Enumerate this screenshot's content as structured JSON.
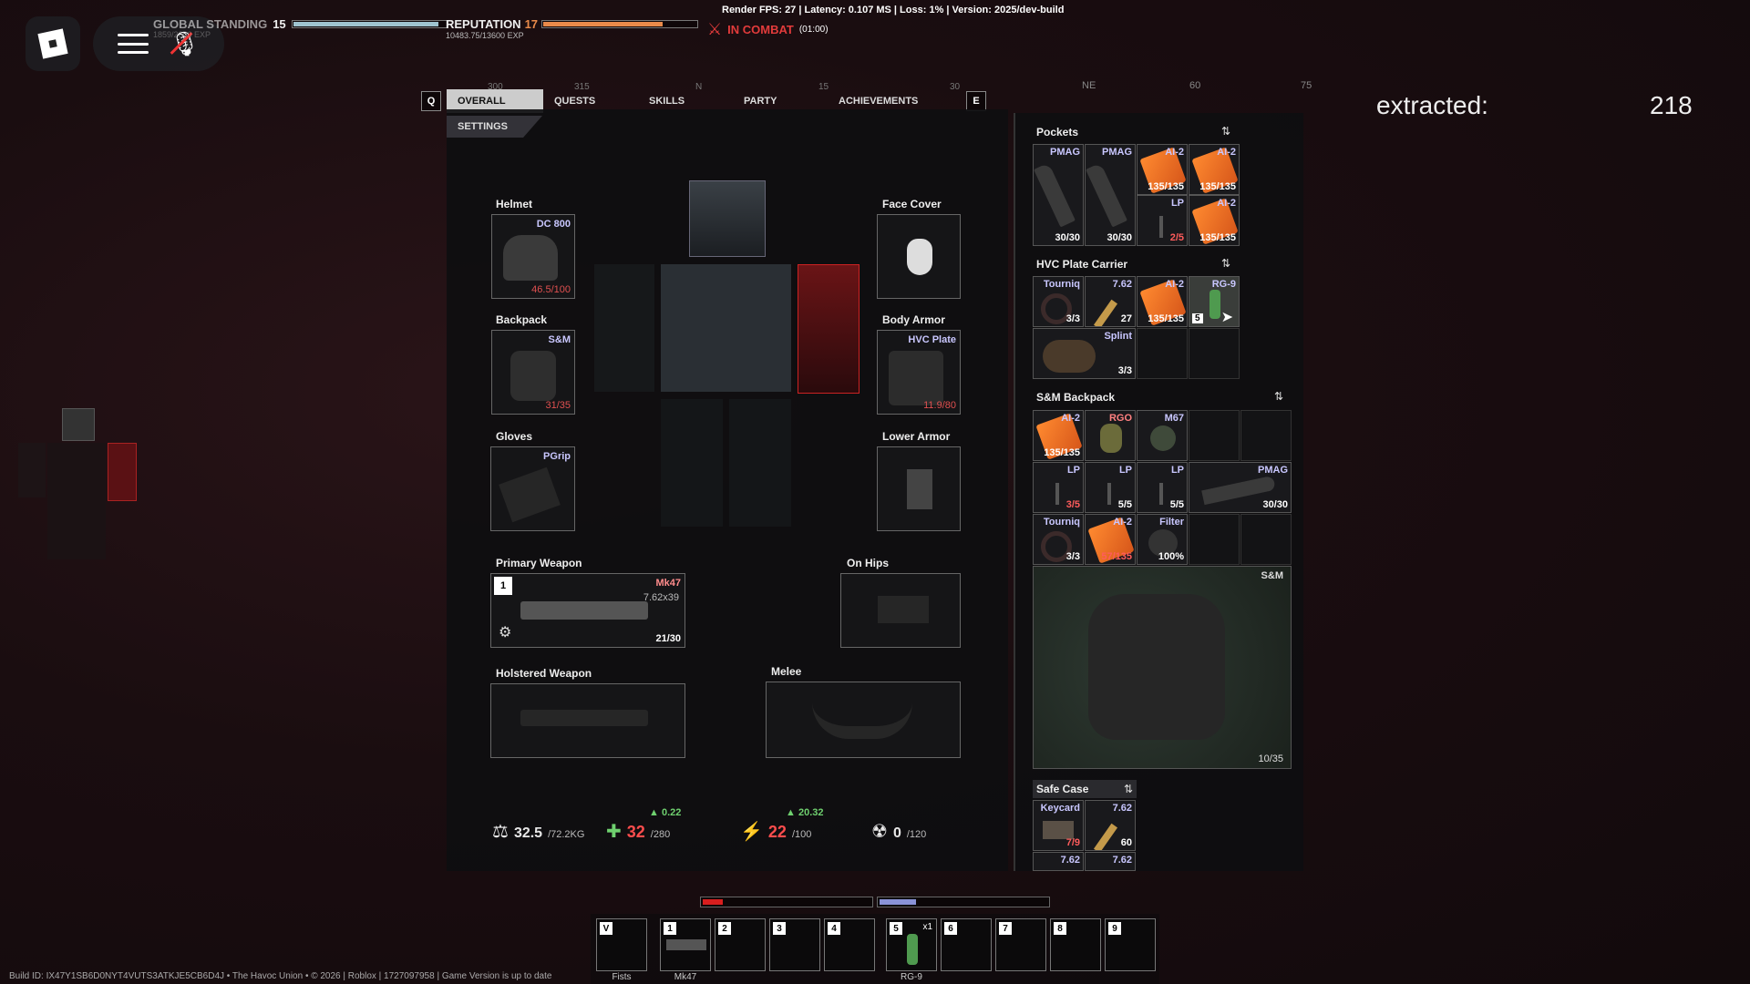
{
  "hud": {
    "global_standing_label": "GLOBAL STANDING",
    "global_standing_level": "15",
    "global_standing_fill": 0.95,
    "global_standing_sub": "1859/2000 EXP",
    "reputation_label": "REPUTATION",
    "reputation_level": "17",
    "reputation_fill": 0.78,
    "reputation_sub": "10483.75/13600 EXP",
    "perf": "Render FPS: 27 | Latency: 0.107 MS | Loss: 1% | Version: 2025/dev-build",
    "combat_label": "IN COMBAT",
    "combat_timer": "(01:00)",
    "extracted_label": "extracted:",
    "extracted_value": "218"
  },
  "compass": {
    "left": [
      "300",
      "315",
      "N",
      "15",
      "30"
    ],
    "right": [
      "NE",
      "60",
      "75"
    ]
  },
  "tabs": {
    "key_left": "Q",
    "key_right": "E",
    "items": [
      "OVERALL",
      "QUESTS",
      "SKILLS",
      "PARTY",
      "ACHIEVEMENTS"
    ],
    "settings": "SETTINGS"
  },
  "equipment": {
    "helmet": {
      "label": "Helmet",
      "name": "DC 800",
      "durability": "46.5/100"
    },
    "face_cover": {
      "label": "Face Cover"
    },
    "backpack": {
      "label": "Backpack",
      "name": "S&M",
      "capacity": "31/35"
    },
    "body_armor": {
      "label": "Body Armor",
      "name": "HVC Plate",
      "durability": "11.9/80"
    },
    "gloves": {
      "label": "Gloves",
      "name": "PGrip"
    },
    "lower_armor": {
      "label": "Lower Armor"
    },
    "primary": {
      "label": "Primary Weapon",
      "slot": "1",
      "name": "Mk47",
      "caliber": "7.62x39",
      "ammo": "21/30"
    },
    "on_hips": {
      "label": "On Hips"
    },
    "holstered": {
      "label": "Holstered Weapon"
    },
    "melee": {
      "label": "Melee"
    }
  },
  "bottom_stats": {
    "weight": "32.5",
    "weight_max": "/72.2KG",
    "health_delta": "0.22",
    "health": "32",
    "health_max": "/280",
    "energy_delta": "20.32",
    "energy": "22",
    "energy_max": "/100",
    "radiation": "0",
    "radiation_max": "/120"
  },
  "pockets": {
    "title": "Pockets",
    "items": [
      {
        "name": "PMAG",
        "count": "30/30",
        "kind": "mag"
      },
      {
        "name": "PMAG",
        "count": "30/30",
        "kind": "mag"
      },
      {
        "name": "AI-2",
        "count": "135/135",
        "kind": "orange"
      },
      {
        "name": "AI-2",
        "count": "135/135",
        "kind": "orange"
      },
      {
        "name": "LP",
        "count": "2/5",
        "kind": "lp"
      },
      {
        "name": "AI-2",
        "count": "135/135",
        "kind": "orange"
      }
    ]
  },
  "carrier": {
    "title": "HVC Plate Carrier",
    "items": [
      {
        "name": "Tourniq",
        "count": "3/3"
      },
      {
        "name": "7.62",
        "count": "27"
      },
      {
        "name": "AI-2",
        "count": "135/135"
      },
      {
        "name": "RG-9",
        "count": "5"
      },
      {
        "name": "Splint",
        "count": "3/3"
      }
    ]
  },
  "backpack": {
    "title": "S&M Backpack",
    "items": [
      {
        "name": "AI-2",
        "count": "135/135"
      },
      {
        "name": "RGO",
        "count": ""
      },
      {
        "name": "M67",
        "count": ""
      },
      {
        "name": "LP",
        "count": "3/5"
      },
      {
        "name": "LP",
        "count": "5/5"
      },
      {
        "name": "LP",
        "count": "5/5"
      },
      {
        "name": "PMAG",
        "count": "30/30"
      },
      {
        "name": "Tourniq",
        "count": "3/3"
      },
      {
        "name": "AI-2",
        "count": "57/135"
      },
      {
        "name": "Filter",
        "count": "100%"
      }
    ],
    "preview_name": "S&M",
    "preview_capacity": "10/35"
  },
  "safe_case": {
    "title": "Safe Case",
    "items": [
      {
        "name": "Keycard",
        "count": "7/9"
      },
      {
        "name": "7.62",
        "count": "60"
      },
      {
        "name": "7.62",
        "count": ""
      },
      {
        "name": "7.62",
        "count": ""
      }
    ]
  },
  "hotbar": {
    "keys": [
      "V",
      "1",
      "2",
      "3",
      "4",
      "5",
      "6",
      "7",
      "8",
      "9"
    ],
    "labels": [
      "Fists",
      "Mk47",
      "",
      "",
      "",
      "RG-9",
      "",
      "",
      "",
      ""
    ],
    "slot5_count": "x1",
    "health_fill": 0.12,
    "stamina_fill": 0.22
  },
  "build_id": "Build ID: IX47Y1SB6D0NYT4VUTS3ATKJE5CB6D4J • The Havoc Union • © 2026 | Roblox | 1727097958 | Game Version is up to date",
  "colors": {
    "standing": "#9ec3cf",
    "reputation": "#e98a4a",
    "health_bar": "#d81e1e",
    "stamina_bar": "#8a93d8",
    "danger": "#e23b3b"
  }
}
